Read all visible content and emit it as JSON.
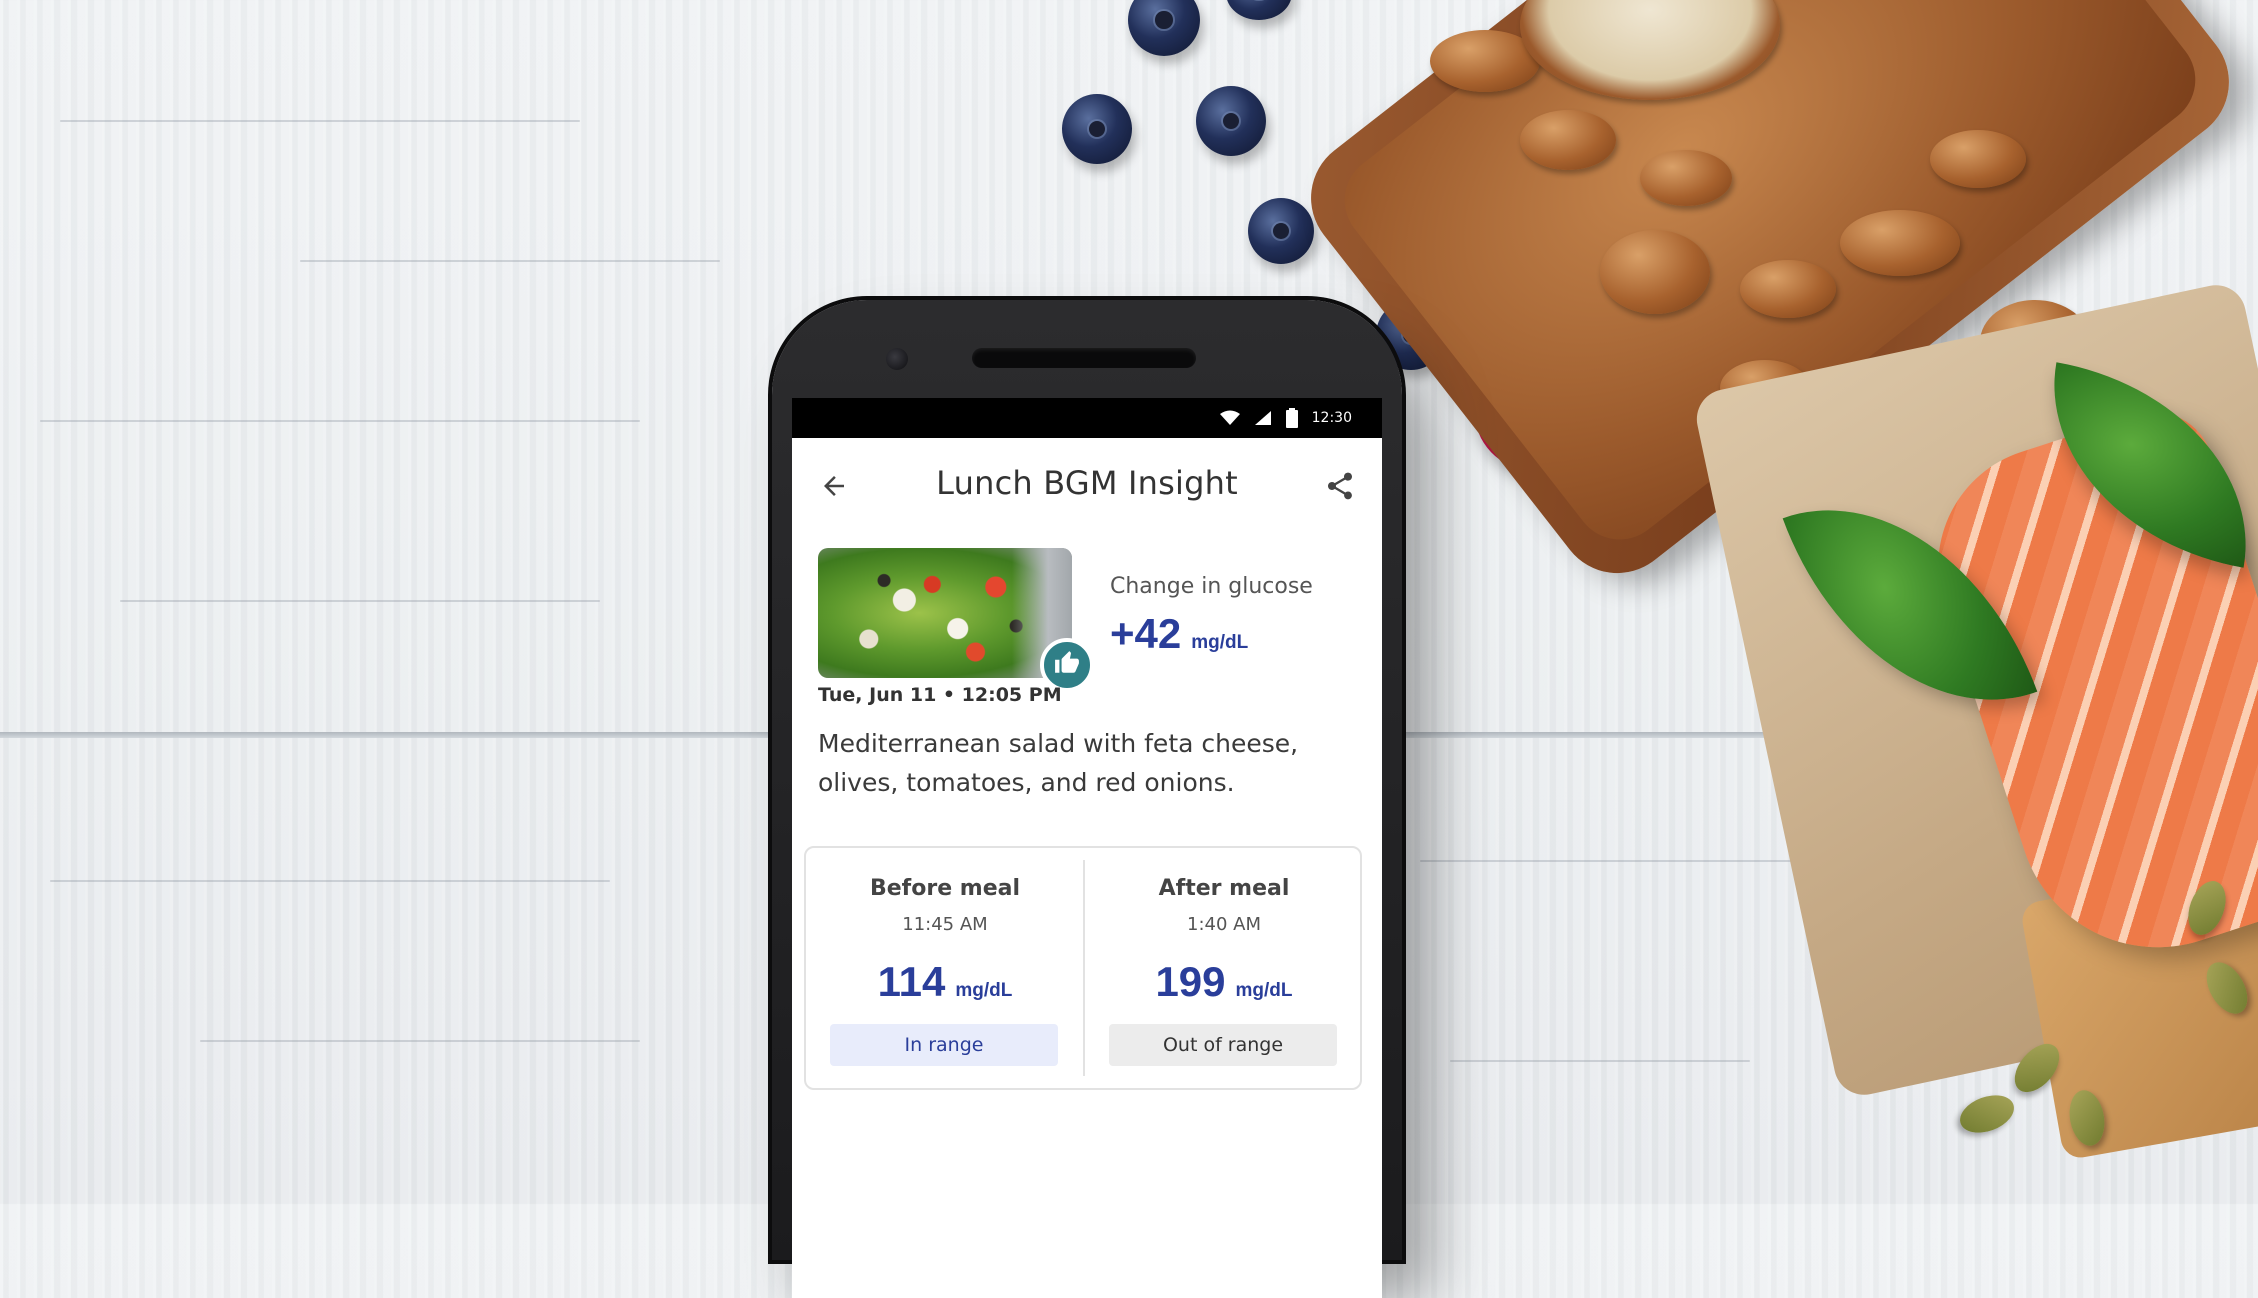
{
  "status_bar": {
    "time": "12:30"
  },
  "app_bar": {
    "title": "Lunch BGM Insight"
  },
  "summary": {
    "change_label": "Change in glucose",
    "change_value": "+42",
    "change_unit": "mg/dL"
  },
  "meal": {
    "timestamp": "Tue, Jun 11 • 12:05 PM",
    "description": "Mediterranean salad with feta cheese, olives, tomatoes, and red onions."
  },
  "readings": [
    {
      "label": "Before meal",
      "time": "11:45 AM",
      "value": "114",
      "unit": "mg/dL",
      "status": "In range"
    },
    {
      "label": "After meal",
      "time": "1:40 AM",
      "value": "199",
      "unit": "mg/dL",
      "status": "Out of range"
    }
  ],
  "colors": {
    "accent": "#2a3e9a",
    "badge": "#2f7f87",
    "in_range_bg": "#e8ecfb",
    "out_range_bg": "#ececec"
  },
  "icons": [
    "back-arrow-icon",
    "share-icon",
    "thumbs-up-icon",
    "wifi-icon",
    "signal-icon",
    "battery-icon"
  ]
}
